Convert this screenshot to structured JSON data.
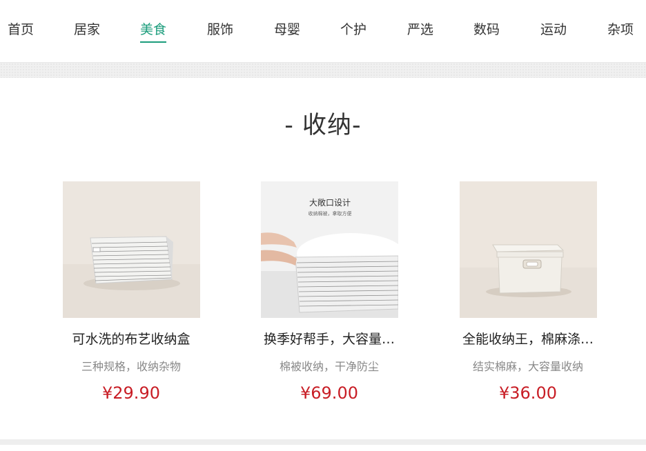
{
  "nav": {
    "items": [
      {
        "label": "首页",
        "active": false
      },
      {
        "label": "居家",
        "active": false
      },
      {
        "label": "美食",
        "active": true
      },
      {
        "label": "服饰",
        "active": false
      },
      {
        "label": "母婴",
        "active": false
      },
      {
        "label": "个护",
        "active": false
      },
      {
        "label": "严选",
        "active": false
      },
      {
        "label": "数码",
        "active": false
      },
      {
        "label": "运动",
        "active": false
      },
      {
        "label": "杂项",
        "active": false
      }
    ]
  },
  "section": {
    "title": "- 收纳-"
  },
  "products": [
    {
      "name": "可水洗的布艺收纳盒",
      "desc": "三种规格，收纳杂物",
      "price": "¥29.90",
      "image_icon": "fabric-storage-basket-image"
    },
    {
      "name": "换季好帮手，大容量…",
      "desc": "棉被收纳，干净防尘",
      "price": "¥69.00",
      "image_icon": "quilt-storage-bag-image",
      "image_text": {
        "headline": "大敞口设计",
        "sub": "收纳棉被，拿取方便"
      }
    },
    {
      "name": "全能收纳王，棉麻涤…",
      "desc": "结实棉麻，大容量收纳",
      "price": "¥36.00",
      "image_icon": "lidded-storage-box-image"
    }
  ],
  "colors": {
    "accent": "#1a9c7b",
    "price": "#c81d25",
    "muted": "#888888"
  }
}
